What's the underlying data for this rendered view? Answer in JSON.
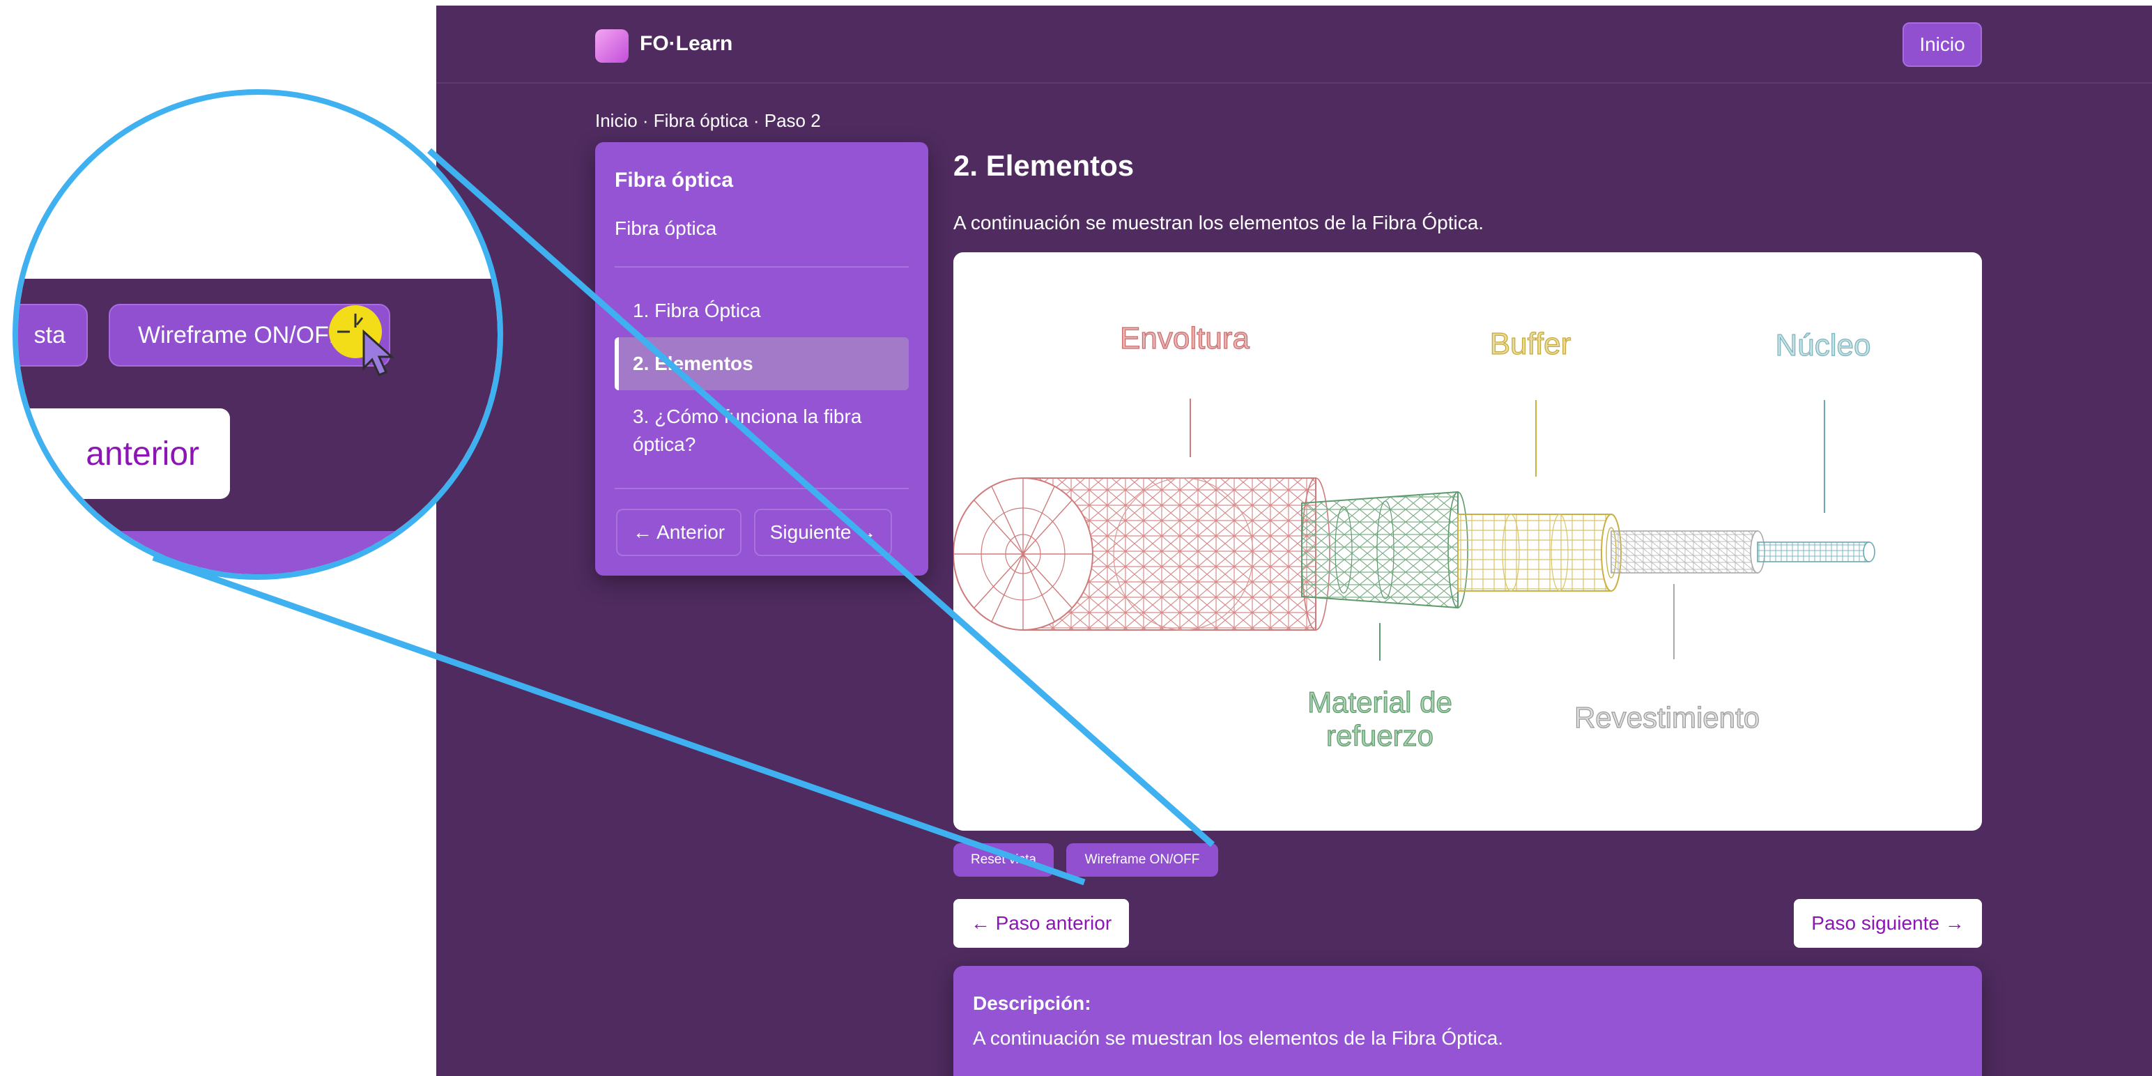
{
  "header": {
    "brand": "FO·Learn",
    "home_button": "Inicio"
  },
  "breadcrumb": "Inicio · Fibra óptica · Paso 2",
  "sidebar": {
    "title": "Fibra óptica",
    "subtitle": "Fibra óptica",
    "items": [
      {
        "label": "1. Fibra Óptica"
      },
      {
        "label": "2. Elementos"
      },
      {
        "label": "3. ¿Cómo funciona la fibra"
      },
      {
        "label": "óptica?"
      }
    ],
    "prev_button": "← Anterior",
    "next_button": "Siguiente →"
  },
  "main": {
    "title": "2. Elementos",
    "intro": "A continuación se muestran los elementos de la Fibra Óptica.",
    "diagram_labels": {
      "envoltura": "Envoltura",
      "buffer": "Buffer",
      "nucleo": "Núcleo",
      "material_1": "Material de",
      "material_2": "refuerzo",
      "revestimiento": "Revestimiento"
    },
    "reset_button": "Reset vista",
    "wireframe_button": "Wireframe ON/OFF",
    "prev_step": "← Paso anterior",
    "next_step": "Paso siguiente →"
  },
  "description": {
    "title": "Descripción:",
    "text": "A continuación se muestran los elementos de la Fibra Óptica."
  },
  "zoom": {
    "button_left_fragment": "sta",
    "wireframe_button": "Wireframe ON/OFF",
    "nav_fragment": "anterior"
  },
  "colors": {
    "background": "#4f2b5f",
    "panel": "#9454d3",
    "accent": "#8b16b4",
    "callout": "#3fb0f0",
    "cursor_highlight": "#f3dd18"
  }
}
